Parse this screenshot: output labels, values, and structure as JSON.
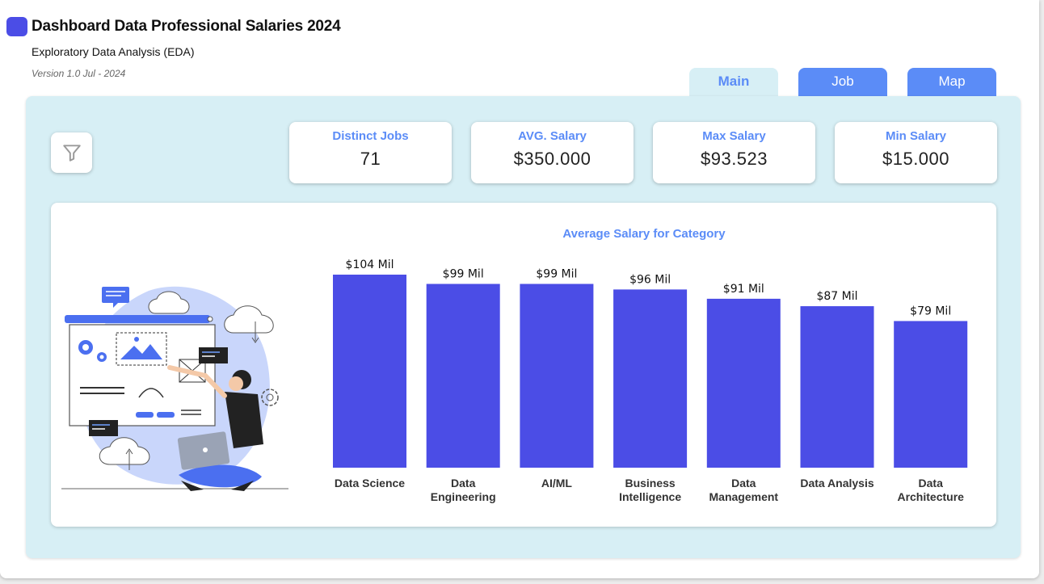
{
  "header": {
    "title": "Dashboard Data Professional Salaries 2024",
    "subtitle": "Exploratory Data Analysis (EDA)",
    "version": "Version 1.0 Jul - 2024"
  },
  "tabs": [
    {
      "label": "Main",
      "active": true
    },
    {
      "label": "Job",
      "active": false
    },
    {
      "label": "Map",
      "active": false
    }
  ],
  "filter": {
    "icon": "filter-icon"
  },
  "kpis": [
    {
      "label": "Distinct Jobs",
      "value": "71"
    },
    {
      "label": "AVG. Salary",
      "value": "$350.000"
    },
    {
      "label": "Max Salary",
      "value": "$93.523"
    },
    {
      "label": "Min Salary",
      "value": "$15.000"
    }
  ],
  "colors": {
    "accent": "#4b4de6",
    "tab_blue": "#5b8cf7",
    "panel_bg": "#d7eff5"
  },
  "chart_data": {
    "type": "bar",
    "title": "Average Salary for Category",
    "categories": [
      "Data Science",
      "Data Engineering",
      "AI/ML",
      "Business Intelligence",
      "Data Management",
      "Data Analysis",
      "Data Architecture"
    ],
    "category_lines": [
      [
        "Data Science"
      ],
      [
        "Data",
        "Engineering"
      ],
      [
        "AI/ML"
      ],
      [
        "Business",
        "Intelligence"
      ],
      [
        "Data",
        "Management"
      ],
      [
        "Data Analysis"
      ],
      [
        "Data",
        "Architecture"
      ]
    ],
    "values": [
      104,
      99,
      99,
      96,
      91,
      87,
      79
    ],
    "data_labels": [
      "$104 Mil",
      "$99 Mil",
      "$99 Mil",
      "$96 Mil",
      "$91 Mil",
      "$87 Mil",
      "$79 Mil"
    ],
    "unit": "Mil",
    "ylim": [
      0,
      104
    ],
    "grid": false,
    "bar_color": "#4b4de6"
  }
}
